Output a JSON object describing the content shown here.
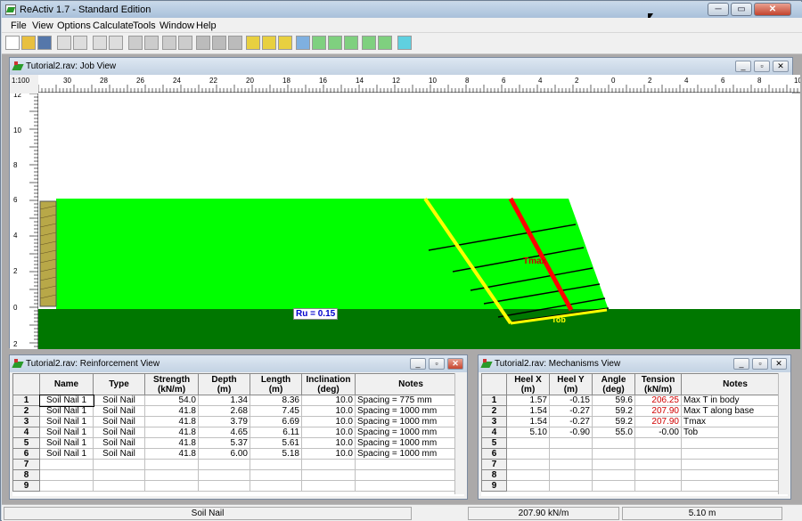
{
  "app": {
    "title": "ReActiv 1.7 - Standard Edition",
    "window_controls": [
      "─",
      "▭",
      "✕"
    ]
  },
  "menu": [
    "File",
    "View",
    "Options",
    "Calculate",
    "Tools",
    "Window",
    "Help"
  ],
  "toolbar_icons": [
    "new-icon",
    "open-icon",
    "save-icon",
    "print-preview-icon",
    "print-icon",
    "zoom-in-icon",
    "zoom-out-icon",
    "copy-icon",
    "paste-icon",
    "hammer-icon",
    "tool-icon",
    "reinforcement-icon",
    "load-down-icon",
    "surcharge-icon",
    "properties-icon",
    "calc-icon",
    "lightning-icon",
    "slope-view-icon",
    "layers-view-icon",
    "mechanism-view-icon",
    "base-view-icon",
    "soil-view-icon",
    "results-view-icon",
    "help-icon"
  ],
  "job_view": {
    "title": "Tutorial2.rav: Job View",
    "scale": "1:100",
    "ruler_top": [
      "30",
      "28",
      "26",
      "24",
      "22",
      "20",
      "18",
      "16",
      "14",
      "12",
      "10",
      "8",
      "6",
      "4",
      "2",
      "0",
      "2",
      "4",
      "6",
      "8",
      "10"
    ],
    "ruler_left": [
      "12",
      "10",
      "8",
      "6",
      "4",
      "2",
      "0",
      "2"
    ],
    "ru_label": "Ru = 0.15",
    "tmax_label": "Tmax",
    "tob_label": "Tob",
    "colors": {
      "soil": "#00ff00",
      "foundation": "#007700",
      "tmax_line": "#ff0000",
      "tob_line": "#ffff00",
      "nails": "#000000",
      "facing": "#b0a040"
    }
  },
  "reinforcement_view": {
    "title": "Tutorial2.rav: Reinforcement View",
    "columns": [
      "",
      "Name",
      "Type",
      "Strength\n(kN/m)",
      "Depth\n(m)",
      "Length\n(m)",
      "Inclination\n(deg)",
      "Notes"
    ],
    "rows": [
      {
        "n": "1",
        "name": "Soil Nail 1",
        "type": "Soil Nail",
        "strength": "54.0",
        "depth": "1.34",
        "length": "8.36",
        "incl": "10.0",
        "notes": "Spacing = 775 mm"
      },
      {
        "n": "2",
        "name": "Soil Nail 1",
        "type": "Soil Nail",
        "strength": "41.8",
        "depth": "2.68",
        "length": "7.45",
        "incl": "10.0",
        "notes": "Spacing = 1000 mm"
      },
      {
        "n": "3",
        "name": "Soil Nail 1",
        "type": "Soil Nail",
        "strength": "41.8",
        "depth": "3.79",
        "length": "6.69",
        "incl": "10.0",
        "notes": "Spacing = 1000 mm"
      },
      {
        "n": "4",
        "name": "Soil Nail 1",
        "type": "Soil Nail",
        "strength": "41.8",
        "depth": "4.65",
        "length": "6.11",
        "incl": "10.0",
        "notes": "Spacing = 1000 mm"
      },
      {
        "n": "5",
        "name": "Soil Nail 1",
        "type": "Soil Nail",
        "strength": "41.8",
        "depth": "5.37",
        "length": "5.61",
        "incl": "10.0",
        "notes": "Spacing = 1000 mm"
      },
      {
        "n": "6",
        "name": "Soil Nail 1",
        "type": "Soil Nail",
        "strength": "41.8",
        "depth": "6.00",
        "length": "5.18",
        "incl": "10.0",
        "notes": "Spacing = 1000 mm"
      },
      {
        "n": "7",
        "name": "",
        "type": "",
        "strength": "",
        "depth": "",
        "length": "",
        "incl": "",
        "notes": ""
      },
      {
        "n": "8",
        "name": "",
        "type": "",
        "strength": "",
        "depth": "",
        "length": "",
        "incl": "",
        "notes": ""
      },
      {
        "n": "9",
        "name": "",
        "type": "",
        "strength": "",
        "depth": "",
        "length": "",
        "incl": "",
        "notes": ""
      }
    ]
  },
  "mechanisms_view": {
    "title": "Tutorial2.rav: Mechanisms View",
    "columns": [
      "",
      "Heel X\n(m)",
      "Heel Y\n(m)",
      "Angle\n(deg)",
      "Tension\n(kN/m)",
      "Notes"
    ],
    "rows": [
      {
        "n": "1",
        "hx": "1.57",
        "hy": "-0.15",
        "angle": "59.6",
        "tension": "206.25",
        "notes": "Max T in body",
        "red": true
      },
      {
        "n": "2",
        "hx": "1.54",
        "hy": "-0.27",
        "angle": "59.2",
        "tension": "207.90",
        "notes": "Max T along base",
        "red": true
      },
      {
        "n": "3",
        "hx": "1.54",
        "hy": "-0.27",
        "angle": "59.2",
        "tension": "207.90",
        "notes": "Tmax",
        "red": true
      },
      {
        "n": "4",
        "hx": "5.10",
        "hy": "-0.90",
        "angle": "55.0",
        "tension": "-0.00",
        "notes": "Tob",
        "red": false
      },
      {
        "n": "5",
        "hx": "",
        "hy": "",
        "angle": "",
        "tension": "",
        "notes": "",
        "red": false
      },
      {
        "n": "6",
        "hx": "",
        "hy": "",
        "angle": "",
        "tension": "",
        "notes": "",
        "red": false
      },
      {
        "n": "7",
        "hx": "",
        "hy": "",
        "angle": "",
        "tension": "",
        "notes": "",
        "red": false
      },
      {
        "n": "8",
        "hx": "",
        "hy": "",
        "angle": "",
        "tension": "",
        "notes": "",
        "red": false
      },
      {
        "n": "9",
        "hx": "",
        "hy": "",
        "angle": "",
        "tension": "",
        "notes": "",
        "red": false
      }
    ]
  },
  "status": {
    "panel1": "Soil Nail",
    "panel2": "207.90 kN/m",
    "panel3": "5.10 m"
  }
}
